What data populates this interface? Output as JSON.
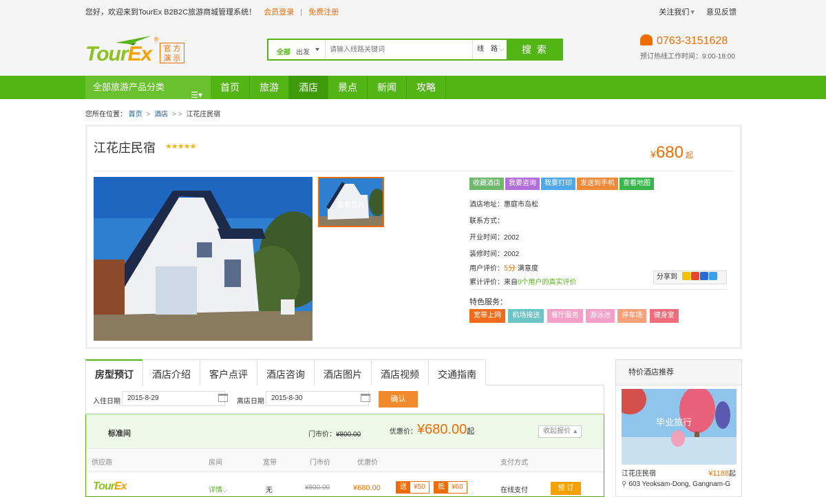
{
  "topbar": {
    "welcome": "您好，欢迎来到TourEx B2B2C旅游商城管理系统！",
    "login": "会员登录",
    "separator": "|",
    "register": "免费注册",
    "follow": "关注我们",
    "follow_caret": "▾",
    "feedback": "意见反馈"
  },
  "logo": {
    "word_a": "Tour",
    "word_b": "Ex",
    "badge_line1": "官 方",
    "badge_line2": "演 示",
    "reg": "®"
  },
  "search": {
    "scope": "全部",
    "departure": "出发",
    "placeholder": "请输入线路关键词",
    "type": "线　路",
    "type_caret": "⌵",
    "button": "搜 索"
  },
  "hotline": {
    "phone": "0763-3151628",
    "hours": "预订热线工作时间：9:00-18:00"
  },
  "nav": {
    "category": "全部旅游产品分类",
    "category_icon": "☰▾",
    "items": [
      "首页",
      "旅游",
      "酒店",
      "景点",
      "新闻",
      "攻略"
    ],
    "active_index": 2
  },
  "breadcrumb": {
    "prefix": "您所在位置：",
    "home": "首页",
    "sep": ">",
    "hotels": "酒店",
    "current": "江花庄民宿"
  },
  "hotel": {
    "name": "江花庄民宿",
    "stars": "★★★★★",
    "price_symbol": "¥",
    "price": "680",
    "price_suffix": "起",
    "thumb_label": "查看图片",
    "buttons": [
      {
        "label": "收藏酒店",
        "color": "#6db86b"
      },
      {
        "label": "我要咨询",
        "color": "#b36ed9"
      },
      {
        "label": "我要打印",
        "color": "#4fa8e8"
      },
      {
        "label": "发送到手机",
        "color": "#f0883a"
      },
      {
        "label": "查看地图",
        "color": "#3ab54a"
      }
    ],
    "address_label": "酒店地址：",
    "address": "惠庭市岛松",
    "contact_label": "联系方式：",
    "contact": "",
    "opened_label": "开业时间：",
    "opened": "2002",
    "renovated_label": "装修时间：",
    "renovated": "2002",
    "rating_label": "用户评价：",
    "rating": "5分",
    "rating_suffix": "满意度",
    "reviews_label": "累计评价：来自",
    "reviews": "0个用户的真实评价",
    "share_label": "分享到",
    "services_label": "特色服务：",
    "services": [
      {
        "label": "宽带上网",
        "color": "#f06c1a"
      },
      {
        "label": "机场接送",
        "color": "#6cc4c4"
      },
      {
        "label": "餐厅服务",
        "color": "#f5a0c8"
      },
      {
        "label": "游泳池",
        "color": "#f5a0c8"
      },
      {
        "label": "停车场",
        "color": "#f7a07a"
      },
      {
        "label": "健身室",
        "color": "#f06c7a"
      }
    ]
  },
  "tabs": [
    "房型预订",
    "酒店介绍",
    "客户点评",
    "酒店咨询",
    "酒店图片",
    "酒店视频",
    "交通指南"
  ],
  "dates": {
    "checkin_label": "入住日期",
    "checkin": "2015-8-29",
    "checkout_label": "离店日期",
    "checkout": "2015-8-30",
    "confirm": "确认"
  },
  "room": {
    "name": "标准间",
    "list_label": "门市价：",
    "list_price": "¥800.00",
    "deal_label": "优惠价：",
    "deal_symbol": "¥",
    "deal_price": "680.00",
    "deal_suffix": "起",
    "fold": "收起报价",
    "fold_caret": "▲",
    "columns": [
      "供应商",
      "房间",
      "宽带",
      "门市价",
      "优惠价",
      "支付方式"
    ],
    "rows": [
      {
        "detail": "详情",
        "detail_caret": "⌵",
        "broadband": "无",
        "list_price": "¥800.00",
        "deal_price": "¥680.00",
        "tag1_k": "送",
        "tag1_v": "¥50",
        "tag2_k": "抵",
        "tag2_v": "¥60",
        "payment": "在线支付",
        "book": "预 订"
      }
    ]
  },
  "sidebar": {
    "title": "特价酒店推荐",
    "item_name": "江花庄民宿",
    "item_price": "¥1188",
    "item_price_suffix": "起",
    "item_address": "603 Yeoksam-Dong, Gangnam-G",
    "image_text": "毕业旅行"
  }
}
